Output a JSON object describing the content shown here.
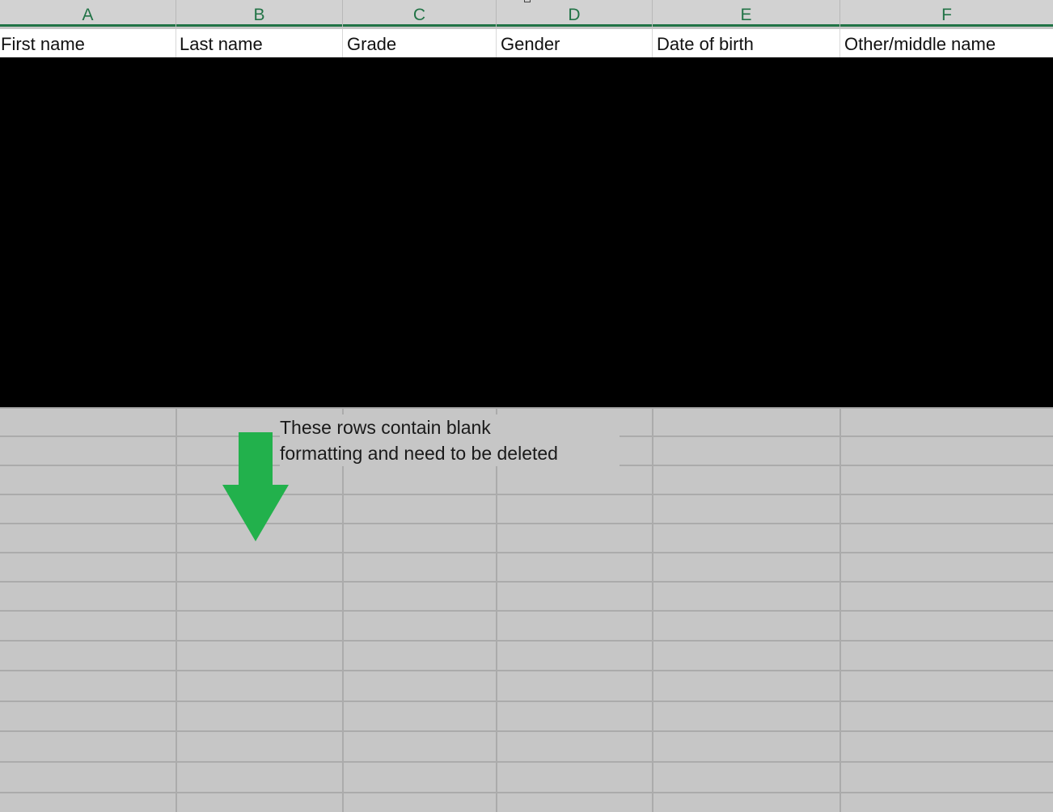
{
  "columns": {
    "letters": [
      "A",
      "B",
      "C",
      "D",
      "E",
      "F"
    ],
    "headers": [
      "First name",
      "Last name",
      "Grade",
      "Gender",
      "Date of birth",
      "Other/middle name"
    ]
  },
  "annotation": {
    "line1": "These rows contain blank",
    "line2": "formatting and need to be deleted",
    "arrow_color": "#22b14c"
  },
  "colors": {
    "accent": "#217346",
    "grid_fill": "#c6c6c6",
    "redaction": "#000000"
  },
  "icons": {
    "arrow": "arrow-down-icon"
  }
}
